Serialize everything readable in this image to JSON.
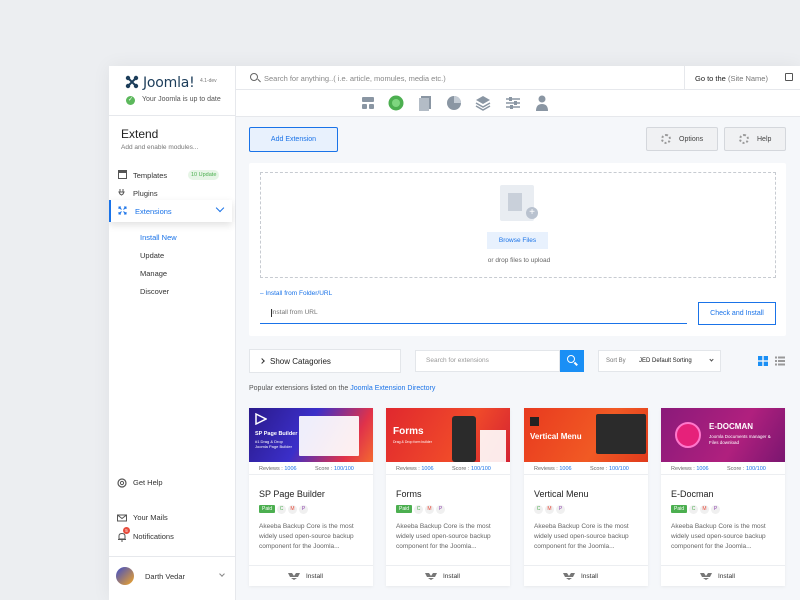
{
  "brand": {
    "name": "Joomla!",
    "version": "4.1-dev",
    "status": "Your Joomla is up to date"
  },
  "search": {
    "placeholder": "Search for anything..( i.e. article, momules, media etc.)"
  },
  "goto": {
    "label": "Go to the",
    "site": "(Site Name)"
  },
  "section": {
    "title": "Extend",
    "subtitle": "Add and enable modules..."
  },
  "nav": {
    "templates": {
      "label": "Templates",
      "badge": "10 Update"
    },
    "plugins": {
      "label": "Plugins"
    },
    "extensions": {
      "label": "Extensions"
    },
    "sub": [
      "Install New",
      "Update",
      "Manage",
      "Discover"
    ]
  },
  "bottom_nav": {
    "help": "Get Help",
    "mails": "Your Mails",
    "mails_count": "5",
    "notifications": "Notifications"
  },
  "user": {
    "name": "Darth Vedar"
  },
  "icon_tabs": [
    "dashboard-icon",
    "extensions-icon",
    "content-icon",
    "reports-icon",
    "layers-icon",
    "settings-sliders-icon",
    "users-icon"
  ],
  "toolbar": {
    "add_label": "Add Extension",
    "options_label": "Options",
    "help_label": "Help"
  },
  "upload": {
    "browse_label": "Browse Files",
    "drop_text": "or drop files to upload",
    "folder_link": "– Install from Folder/URL",
    "url_placeholder": "Install from URL",
    "check_label": "Check and Install"
  },
  "filters": {
    "categories_label": "Show Catagories",
    "search_placeholder": "Search for extensions",
    "sort_key": "Sort By",
    "sort_value": "JED Default Sorting"
  },
  "popular": {
    "prefix": "Popular extensions listed on the ",
    "link": "Joomla Extension Directory"
  },
  "cards": [
    {
      "banner_title": "SP Page Builder",
      "banner_sub": "#1 Drag & Drop Joomla Page Builder",
      "reviews_label": "Reviews :",
      "reviews": "1006",
      "score_label": "Score :",
      "score": "100/100",
      "name": "SP Page Builder",
      "paid": "Paid",
      "tags": [
        "C",
        "M",
        "P"
      ],
      "desc": "Akeeba Backup Core is the most widely used open-source backup component for the Joomla...",
      "install": "Install"
    },
    {
      "banner_title": "Forms",
      "banner_sub": "Drag & Drop form builder",
      "reviews_label": "Reviews :",
      "reviews": "1006",
      "score_label": "Score :",
      "score": "100/100",
      "name": "Forms",
      "paid": "Paid",
      "tags": [
        "C",
        "M",
        "P"
      ],
      "desc": "Akeeba Backup Core is the most widely used open-source backup component for the Joomla...",
      "install": "Install"
    },
    {
      "banner_title": "Vertical Menu",
      "banner_sub": "",
      "reviews_label": "Reviews :",
      "reviews": "1006",
      "score_label": "Score :",
      "score": "100/100",
      "name": "Vertical Menu",
      "paid": "",
      "tags": [
        "C",
        "M",
        "P"
      ],
      "desc": "Akeeba Backup Core is the most widely used open-source backup component for the Joomla...",
      "install": "Install"
    },
    {
      "banner_title": "E-DOCMAN",
      "banner_sub": "Joomla Documents manager & Files download",
      "reviews_label": "Reviews :",
      "reviews": "1006",
      "score_label": "Score :",
      "score": "100/100",
      "name": "E-Docman",
      "paid": "Paid",
      "tags": [
        "C",
        "M",
        "P"
      ],
      "desc": "Akeeba Backup Core is the most widely used open-source backup component for the Joomla...",
      "install": "Install"
    }
  ],
  "colors": {
    "accent": "#1a73e8",
    "success": "#4caf50"
  }
}
